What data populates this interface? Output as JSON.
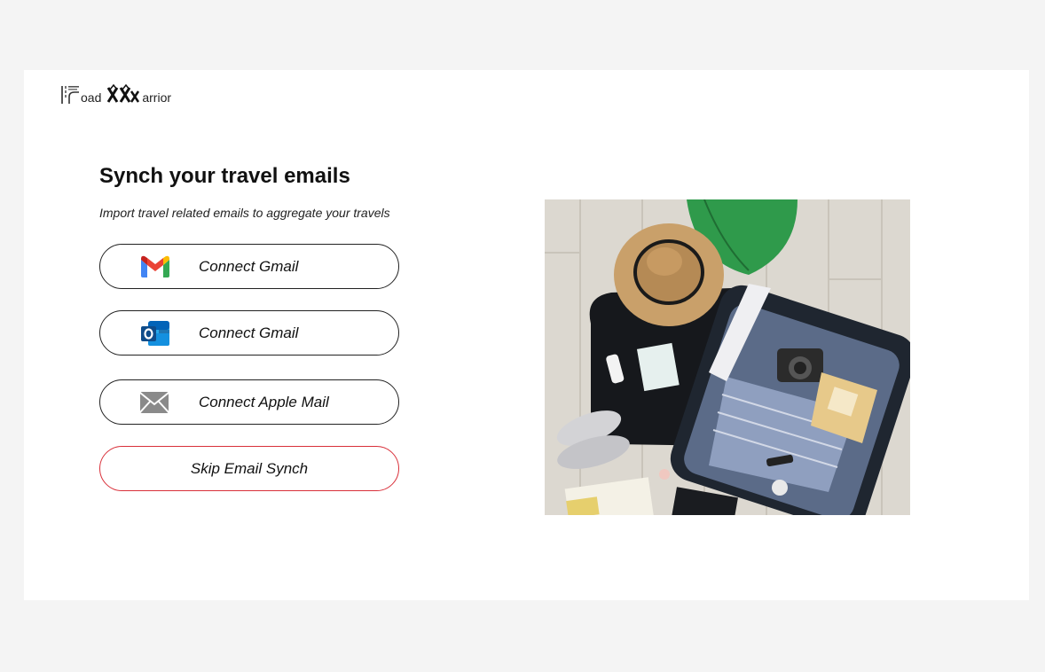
{
  "brand": {
    "logo_part1": "oad",
    "logo_part2": "arrior"
  },
  "page": {
    "title": "Synch your travel emails",
    "subtitle": "Import travel related emails to aggregate your travels"
  },
  "actions": {
    "gmail_label": "Connect Gmail",
    "outlook_label": "Connect Gmail",
    "apple_label": "Connect Apple Mail",
    "skip_label": "Skip Email Synch"
  },
  "icons": {
    "gmail": "gmail-icon",
    "outlook": "outlook-icon",
    "apple_mail": "mail-envelope-icon"
  },
  "colors": {
    "background": "#f4f4f4",
    "card": "#ffffff",
    "skip_border": "#d9303a",
    "button_border": "#222222"
  }
}
